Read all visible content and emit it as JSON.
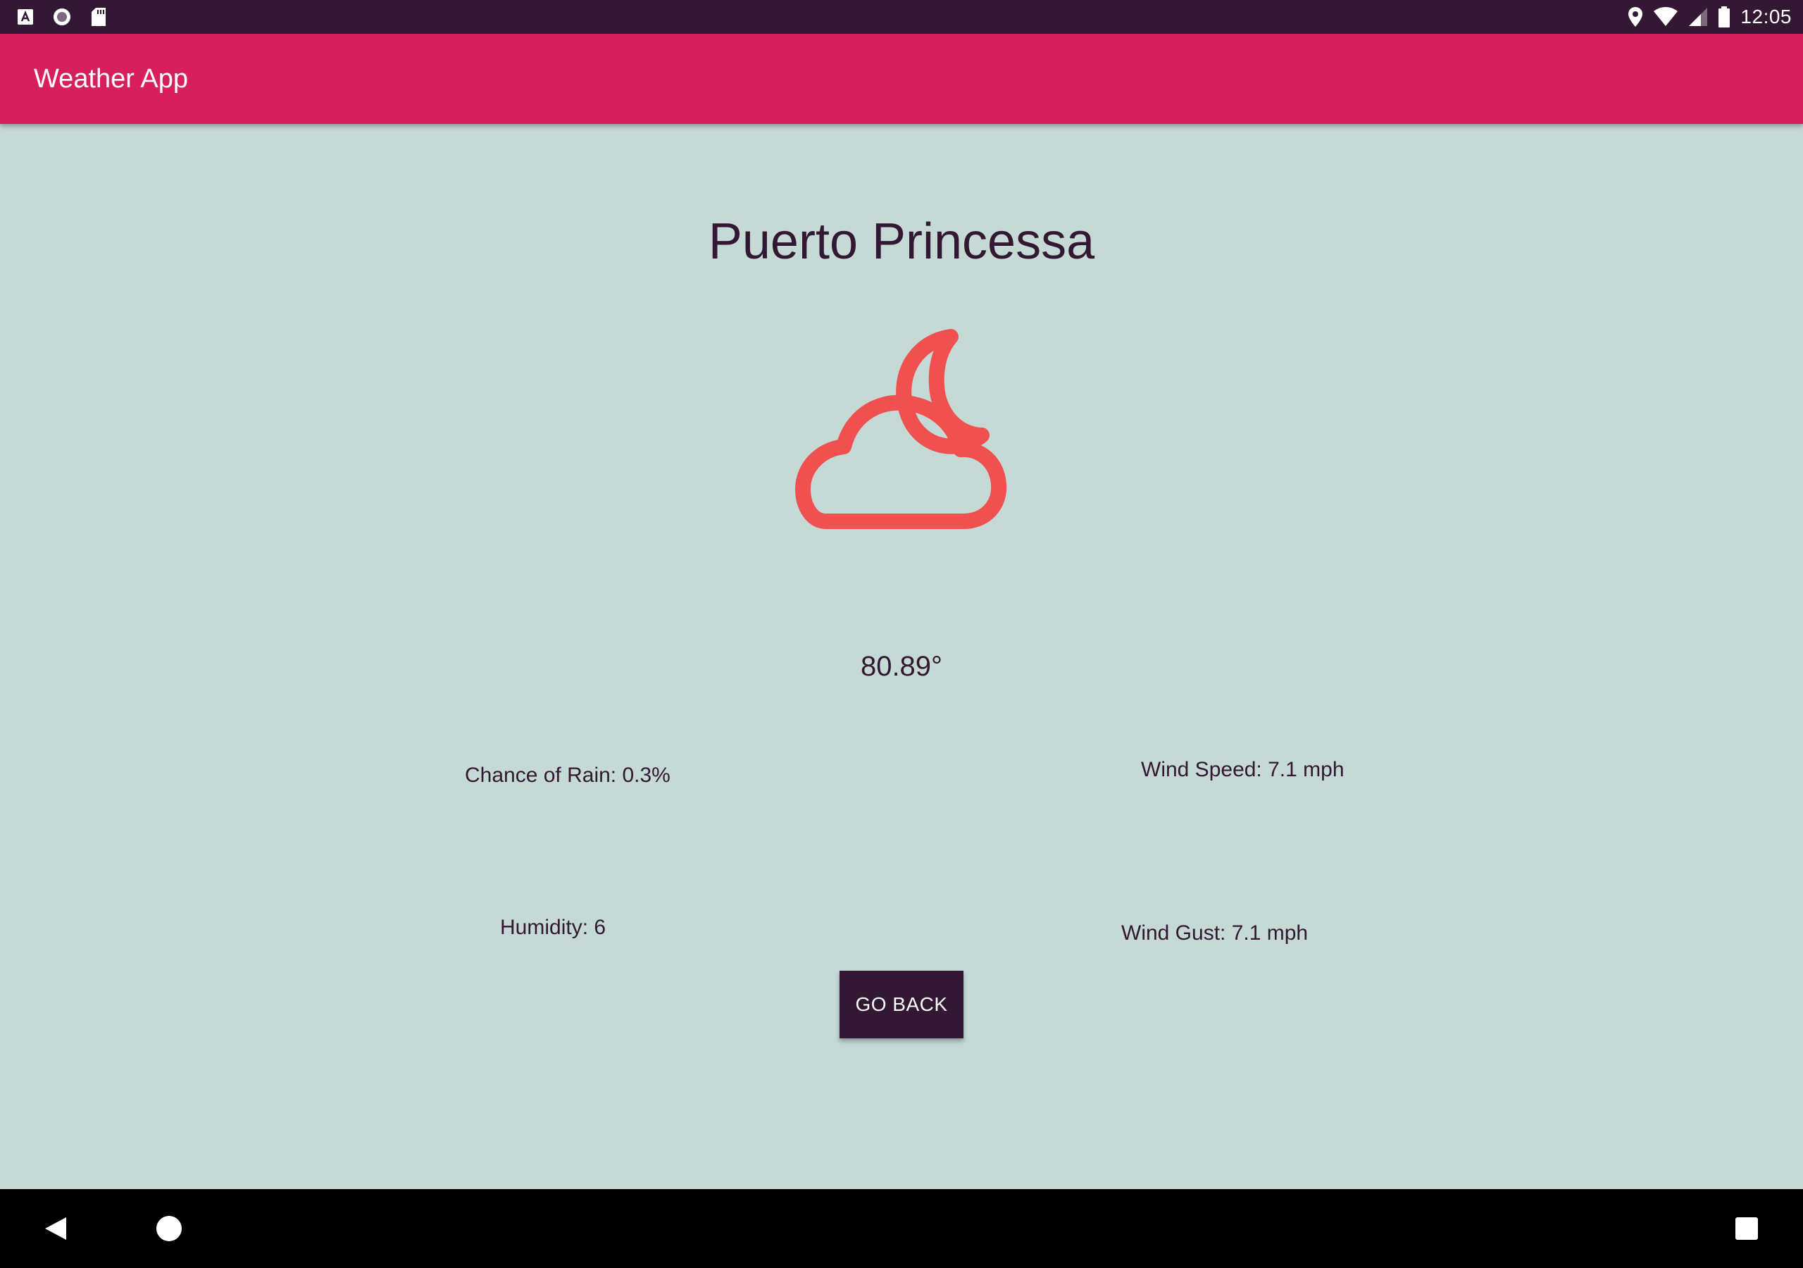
{
  "status_bar": {
    "time": "12:05",
    "left_icons": [
      "a-icon",
      "circle-icon",
      "sd-card-icon"
    ],
    "right_icons": [
      "location-icon",
      "wifi-icon",
      "signal-icon",
      "battery-icon"
    ]
  },
  "app_bar": {
    "title": "Weather App"
  },
  "main": {
    "city": "Puerto Princessa",
    "weather_icon": "partly-cloudy-night-icon",
    "temperature": "80.89°",
    "chance_of_rain": "Chance of Rain: 0.3%",
    "wind_speed": "Wind Speed: 7.1 mph",
    "humidity": "Humidity: 6",
    "wind_gust": "Wind Gust: 7.1 mph",
    "go_back_label": "GO BACK"
  },
  "nav_bar": {
    "icons": [
      "back-icon",
      "home-icon",
      "recents-icon"
    ]
  },
  "colors": {
    "status_bar": "#331833",
    "app_bar": "#d81f5e",
    "background": "#c5d9d5",
    "text": "#331833",
    "icon_accent": "#f0504f",
    "button": "#331833"
  }
}
